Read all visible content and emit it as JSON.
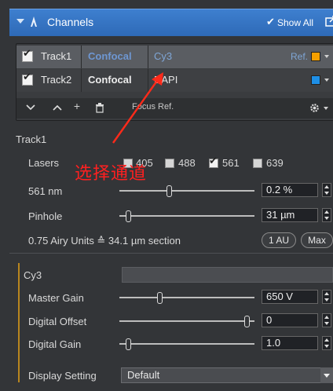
{
  "panel": {
    "title": "Channels",
    "show_all_label": "Show All"
  },
  "tracks": [
    {
      "track": "Track1",
      "mode": "Confocal",
      "channel": "Cy3",
      "ref": "Ref.",
      "color": "#f5a000",
      "mode_color": "#6e97d2",
      "channel_color": "#7fa6d6",
      "checked": true
    },
    {
      "track": "Track2",
      "mode": "Confocal",
      "channel": "DAPI",
      "ref": "",
      "color": "#1e8fe6",
      "mode_color": "#ececec",
      "channel_color": "#e4e4e4",
      "checked": true
    }
  ],
  "toolbar": {
    "focus_ref": "Focus Ref."
  },
  "annotation": "选择通道",
  "track_settings": {
    "heading": "Track1",
    "lasers_label": "Lasers",
    "lasers": [
      {
        "label": "405",
        "checked": false
      },
      {
        "label": "488",
        "checked": false
      },
      {
        "label": "561",
        "checked": true
      },
      {
        "label": "639",
        "checked": false
      }
    ],
    "laser_power_label": "561 nm",
    "laser_power_value": "0.2 %",
    "pinhole_label": "Pinhole",
    "pinhole_value": "31 µm",
    "airy_text": "0.75 Airy Units ≙ 34.1 µm section",
    "au_button": "1 AU",
    "max_button": "Max"
  },
  "channel_settings": {
    "heading": "Cy3",
    "master_gain_label": "Master Gain",
    "master_gain_value": "650 V",
    "digital_offset_label": "Digital Offset",
    "digital_offset_value": "0",
    "digital_gain_label": "Digital Gain",
    "digital_gain_value": "1.0",
    "display_setting_label": "Display Setting",
    "display_setting_value": "Default"
  }
}
